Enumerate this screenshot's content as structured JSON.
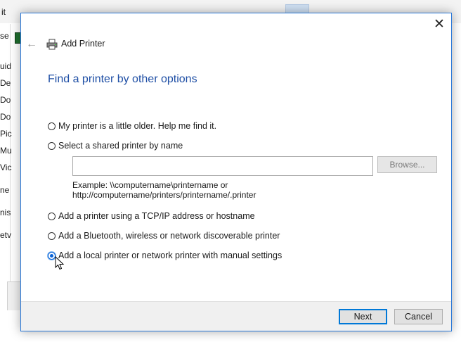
{
  "background": {
    "title_fragment": "it",
    "left_items": [
      "se",
      "uid",
      "De",
      "Do",
      "Do",
      "Pic",
      "Mu",
      "Vic",
      "ne",
      "nis",
      "etv"
    ]
  },
  "dialog": {
    "title": "Add Printer",
    "heading": "Find a printer by other options",
    "options": [
      {
        "label": "My printer is a little older. Help me find it.",
        "checked": false
      },
      {
        "label": "Select a shared printer by name",
        "checked": false
      },
      {
        "label": "Add a printer using a TCP/IP address or hostname",
        "checked": false
      },
      {
        "label": "Add a Bluetooth, wireless or network discoverable printer",
        "checked": false
      },
      {
        "label": "Add a local printer or network printer with manual settings",
        "checked": true
      }
    ],
    "shared_printer_input": {
      "value": "",
      "placeholder": ""
    },
    "browse_label": "Browse...",
    "example_text": "Example: \\\\computername\\printername or\nhttp://computername/printers/printername/.printer",
    "next_label": "Next",
    "cancel_label": "Cancel"
  },
  "colors": {
    "accent": "#1f4fa5",
    "border": "#2b79d8",
    "radio_selected": "#0a64d8"
  },
  "icons": [
    "close-icon",
    "back-arrow-icon",
    "printer-icon",
    "mouse-cursor-icon"
  ]
}
